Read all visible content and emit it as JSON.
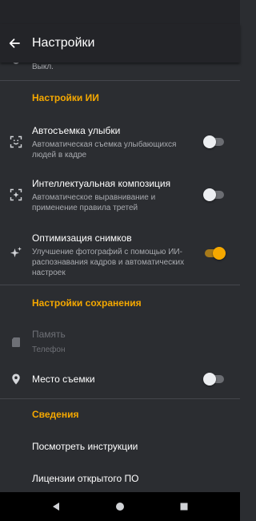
{
  "app_bar": {
    "title": "Настройки",
    "back_icon": "arrow-back-icon"
  },
  "partial_item": {
    "value": "Выкл."
  },
  "sections": {
    "ai": {
      "header": "Настройки ИИ",
      "smile": {
        "title": "Автосъемка улыбки",
        "desc": "Автоматическая съемка улыбающихся людей в кадре",
        "icon": "smile-face-frame-icon",
        "enabled": false
      },
      "composition": {
        "title": "Интеллектуальная композиция",
        "desc": "Автоматическое выравнивание и применение правила третей",
        "icon": "composition-frame-icon",
        "enabled": false
      },
      "optimization": {
        "title": "Оптимизация снимков",
        "desc": "Улучшение фотографий с помощью ИИ-распознавания кадров и автоматических настроек",
        "icon": "sparkle-icon",
        "enabled": true
      }
    },
    "save": {
      "header": "Настройки сохранения",
      "memory": {
        "title": "Память",
        "value": "Телефон",
        "icon": "sd-card-icon",
        "disabled": true
      },
      "location": {
        "title": "Место съемки",
        "icon": "location-pin-icon",
        "enabled": false
      }
    },
    "info": {
      "header": "Сведения",
      "instructions": "Посмотреть инструкции",
      "licenses": "Лицензии открытого ПО"
    }
  },
  "colors": {
    "accent": "#f5a800",
    "background": "#2b2d31",
    "app_bar": "#232428"
  },
  "nav_bar": {
    "back": "nav-back-icon",
    "home": "nav-home-icon",
    "recents": "nav-recents-icon"
  }
}
